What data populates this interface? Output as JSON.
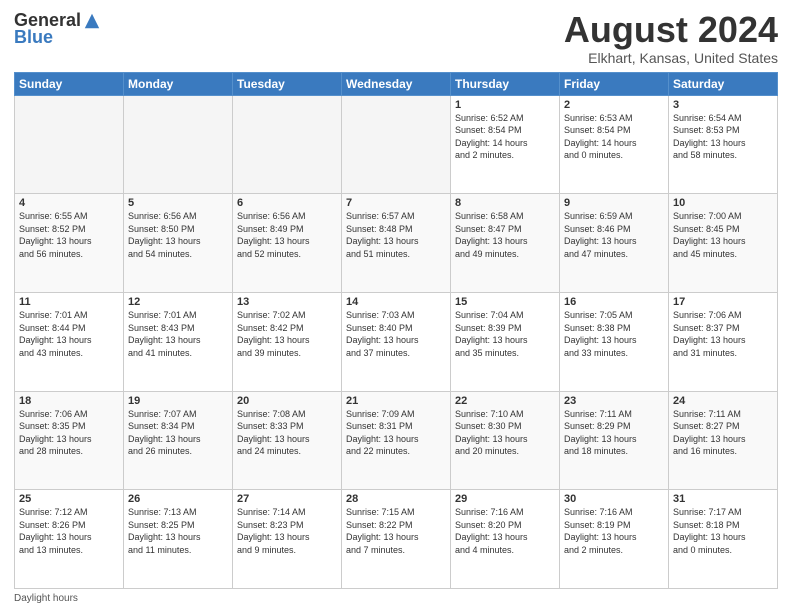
{
  "logo": {
    "general": "General",
    "blue": "Blue"
  },
  "title": "August 2024",
  "subtitle": "Elkhart, Kansas, United States",
  "days_of_week": [
    "Sunday",
    "Monday",
    "Tuesday",
    "Wednesday",
    "Thursday",
    "Friday",
    "Saturday"
  ],
  "footer": "Daylight hours",
  "weeks": [
    [
      {
        "day": "",
        "info": ""
      },
      {
        "day": "",
        "info": ""
      },
      {
        "day": "",
        "info": ""
      },
      {
        "day": "",
        "info": ""
      },
      {
        "day": "1",
        "info": "Sunrise: 6:52 AM\nSunset: 8:54 PM\nDaylight: 14 hours\nand 2 minutes."
      },
      {
        "day": "2",
        "info": "Sunrise: 6:53 AM\nSunset: 8:54 PM\nDaylight: 14 hours\nand 0 minutes."
      },
      {
        "day": "3",
        "info": "Sunrise: 6:54 AM\nSunset: 8:53 PM\nDaylight: 13 hours\nand 58 minutes."
      }
    ],
    [
      {
        "day": "4",
        "info": "Sunrise: 6:55 AM\nSunset: 8:52 PM\nDaylight: 13 hours\nand 56 minutes."
      },
      {
        "day": "5",
        "info": "Sunrise: 6:56 AM\nSunset: 8:50 PM\nDaylight: 13 hours\nand 54 minutes."
      },
      {
        "day": "6",
        "info": "Sunrise: 6:56 AM\nSunset: 8:49 PM\nDaylight: 13 hours\nand 52 minutes."
      },
      {
        "day": "7",
        "info": "Sunrise: 6:57 AM\nSunset: 8:48 PM\nDaylight: 13 hours\nand 51 minutes."
      },
      {
        "day": "8",
        "info": "Sunrise: 6:58 AM\nSunset: 8:47 PM\nDaylight: 13 hours\nand 49 minutes."
      },
      {
        "day": "9",
        "info": "Sunrise: 6:59 AM\nSunset: 8:46 PM\nDaylight: 13 hours\nand 47 minutes."
      },
      {
        "day": "10",
        "info": "Sunrise: 7:00 AM\nSunset: 8:45 PM\nDaylight: 13 hours\nand 45 minutes."
      }
    ],
    [
      {
        "day": "11",
        "info": "Sunrise: 7:01 AM\nSunset: 8:44 PM\nDaylight: 13 hours\nand 43 minutes."
      },
      {
        "day": "12",
        "info": "Sunrise: 7:01 AM\nSunset: 8:43 PM\nDaylight: 13 hours\nand 41 minutes."
      },
      {
        "day": "13",
        "info": "Sunrise: 7:02 AM\nSunset: 8:42 PM\nDaylight: 13 hours\nand 39 minutes."
      },
      {
        "day": "14",
        "info": "Sunrise: 7:03 AM\nSunset: 8:40 PM\nDaylight: 13 hours\nand 37 minutes."
      },
      {
        "day": "15",
        "info": "Sunrise: 7:04 AM\nSunset: 8:39 PM\nDaylight: 13 hours\nand 35 minutes."
      },
      {
        "day": "16",
        "info": "Sunrise: 7:05 AM\nSunset: 8:38 PM\nDaylight: 13 hours\nand 33 minutes."
      },
      {
        "day": "17",
        "info": "Sunrise: 7:06 AM\nSunset: 8:37 PM\nDaylight: 13 hours\nand 31 minutes."
      }
    ],
    [
      {
        "day": "18",
        "info": "Sunrise: 7:06 AM\nSunset: 8:35 PM\nDaylight: 13 hours\nand 28 minutes."
      },
      {
        "day": "19",
        "info": "Sunrise: 7:07 AM\nSunset: 8:34 PM\nDaylight: 13 hours\nand 26 minutes."
      },
      {
        "day": "20",
        "info": "Sunrise: 7:08 AM\nSunset: 8:33 PM\nDaylight: 13 hours\nand 24 minutes."
      },
      {
        "day": "21",
        "info": "Sunrise: 7:09 AM\nSunset: 8:31 PM\nDaylight: 13 hours\nand 22 minutes."
      },
      {
        "day": "22",
        "info": "Sunrise: 7:10 AM\nSunset: 8:30 PM\nDaylight: 13 hours\nand 20 minutes."
      },
      {
        "day": "23",
        "info": "Sunrise: 7:11 AM\nSunset: 8:29 PM\nDaylight: 13 hours\nand 18 minutes."
      },
      {
        "day": "24",
        "info": "Sunrise: 7:11 AM\nSunset: 8:27 PM\nDaylight: 13 hours\nand 16 minutes."
      }
    ],
    [
      {
        "day": "25",
        "info": "Sunrise: 7:12 AM\nSunset: 8:26 PM\nDaylight: 13 hours\nand 13 minutes."
      },
      {
        "day": "26",
        "info": "Sunrise: 7:13 AM\nSunset: 8:25 PM\nDaylight: 13 hours\nand 11 minutes."
      },
      {
        "day": "27",
        "info": "Sunrise: 7:14 AM\nSunset: 8:23 PM\nDaylight: 13 hours\nand 9 minutes."
      },
      {
        "day": "28",
        "info": "Sunrise: 7:15 AM\nSunset: 8:22 PM\nDaylight: 13 hours\nand 7 minutes."
      },
      {
        "day": "29",
        "info": "Sunrise: 7:16 AM\nSunset: 8:20 PM\nDaylight: 13 hours\nand 4 minutes."
      },
      {
        "day": "30",
        "info": "Sunrise: 7:16 AM\nSunset: 8:19 PM\nDaylight: 13 hours\nand 2 minutes."
      },
      {
        "day": "31",
        "info": "Sunrise: 7:17 AM\nSunset: 8:18 PM\nDaylight: 13 hours\nand 0 minutes."
      }
    ]
  ]
}
